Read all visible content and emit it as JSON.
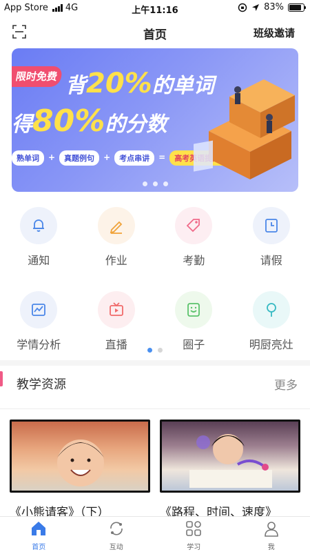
{
  "status_bar": {
    "carrier": "App Store",
    "network": "4G",
    "time": "上午11:16",
    "battery": "83%",
    "battery_level": 0.83
  },
  "header": {
    "title": "首页",
    "right_action": "班级邀请"
  },
  "banner": {
    "tag": "限时免费",
    "line1_a": "背",
    "line1_hl": "20%",
    "line1_b": "的单词",
    "line2_a": "得",
    "line2_hl": "80%",
    "line2_b": "的分数",
    "pills": [
      "熟单词",
      "真题例句",
      "考点串讲"
    ],
    "promo": "高考英语提分权益包",
    "page_count": 3
  },
  "grid": {
    "rows": [
      [
        {
          "label": "通知",
          "icon": "bell-icon",
          "bg": "#eef2fb",
          "color": "#4a86e8"
        },
        {
          "label": "作业",
          "icon": "pencil-icon",
          "bg": "#fdf3e8",
          "color": "#f0a33a"
        },
        {
          "label": "考勤",
          "icon": "tag-icon",
          "bg": "#fdeef2",
          "color": "#f06a8a"
        },
        {
          "label": "请假",
          "icon": "clock-doc-icon",
          "bg": "#eef2fb",
          "color": "#4a86e8"
        }
      ],
      [
        {
          "label": "学情分析",
          "icon": "chart-icon",
          "bg": "#eef2fb",
          "color": "#4a86e8"
        },
        {
          "label": "直播",
          "icon": "tv-icon",
          "bg": "#fdeef0",
          "color": "#f06a6a"
        },
        {
          "label": "圈子",
          "icon": "face-icon",
          "bg": "#eef9ec",
          "color": "#5bc26b"
        },
        {
          "label": "明厨亮灶",
          "icon": "pin-icon",
          "bg": "#e9f8f8",
          "color": "#35b9c2"
        }
      ]
    ],
    "page_count": 2
  },
  "section": {
    "title": "教学资源",
    "more": "更多"
  },
  "resources": [
    {
      "caption": "《小熊请客》（下）"
    },
    {
      "caption": "《路程、时间、速度》"
    }
  ],
  "tabbar": {
    "items": [
      {
        "label": "首页",
        "icon": "home-icon"
      },
      {
        "label": "互动",
        "icon": "interact-icon"
      },
      {
        "label": "学习",
        "icon": "apps-icon"
      },
      {
        "label": "我",
        "icon": "user-icon"
      }
    ],
    "active_color": "#3a7be8"
  }
}
